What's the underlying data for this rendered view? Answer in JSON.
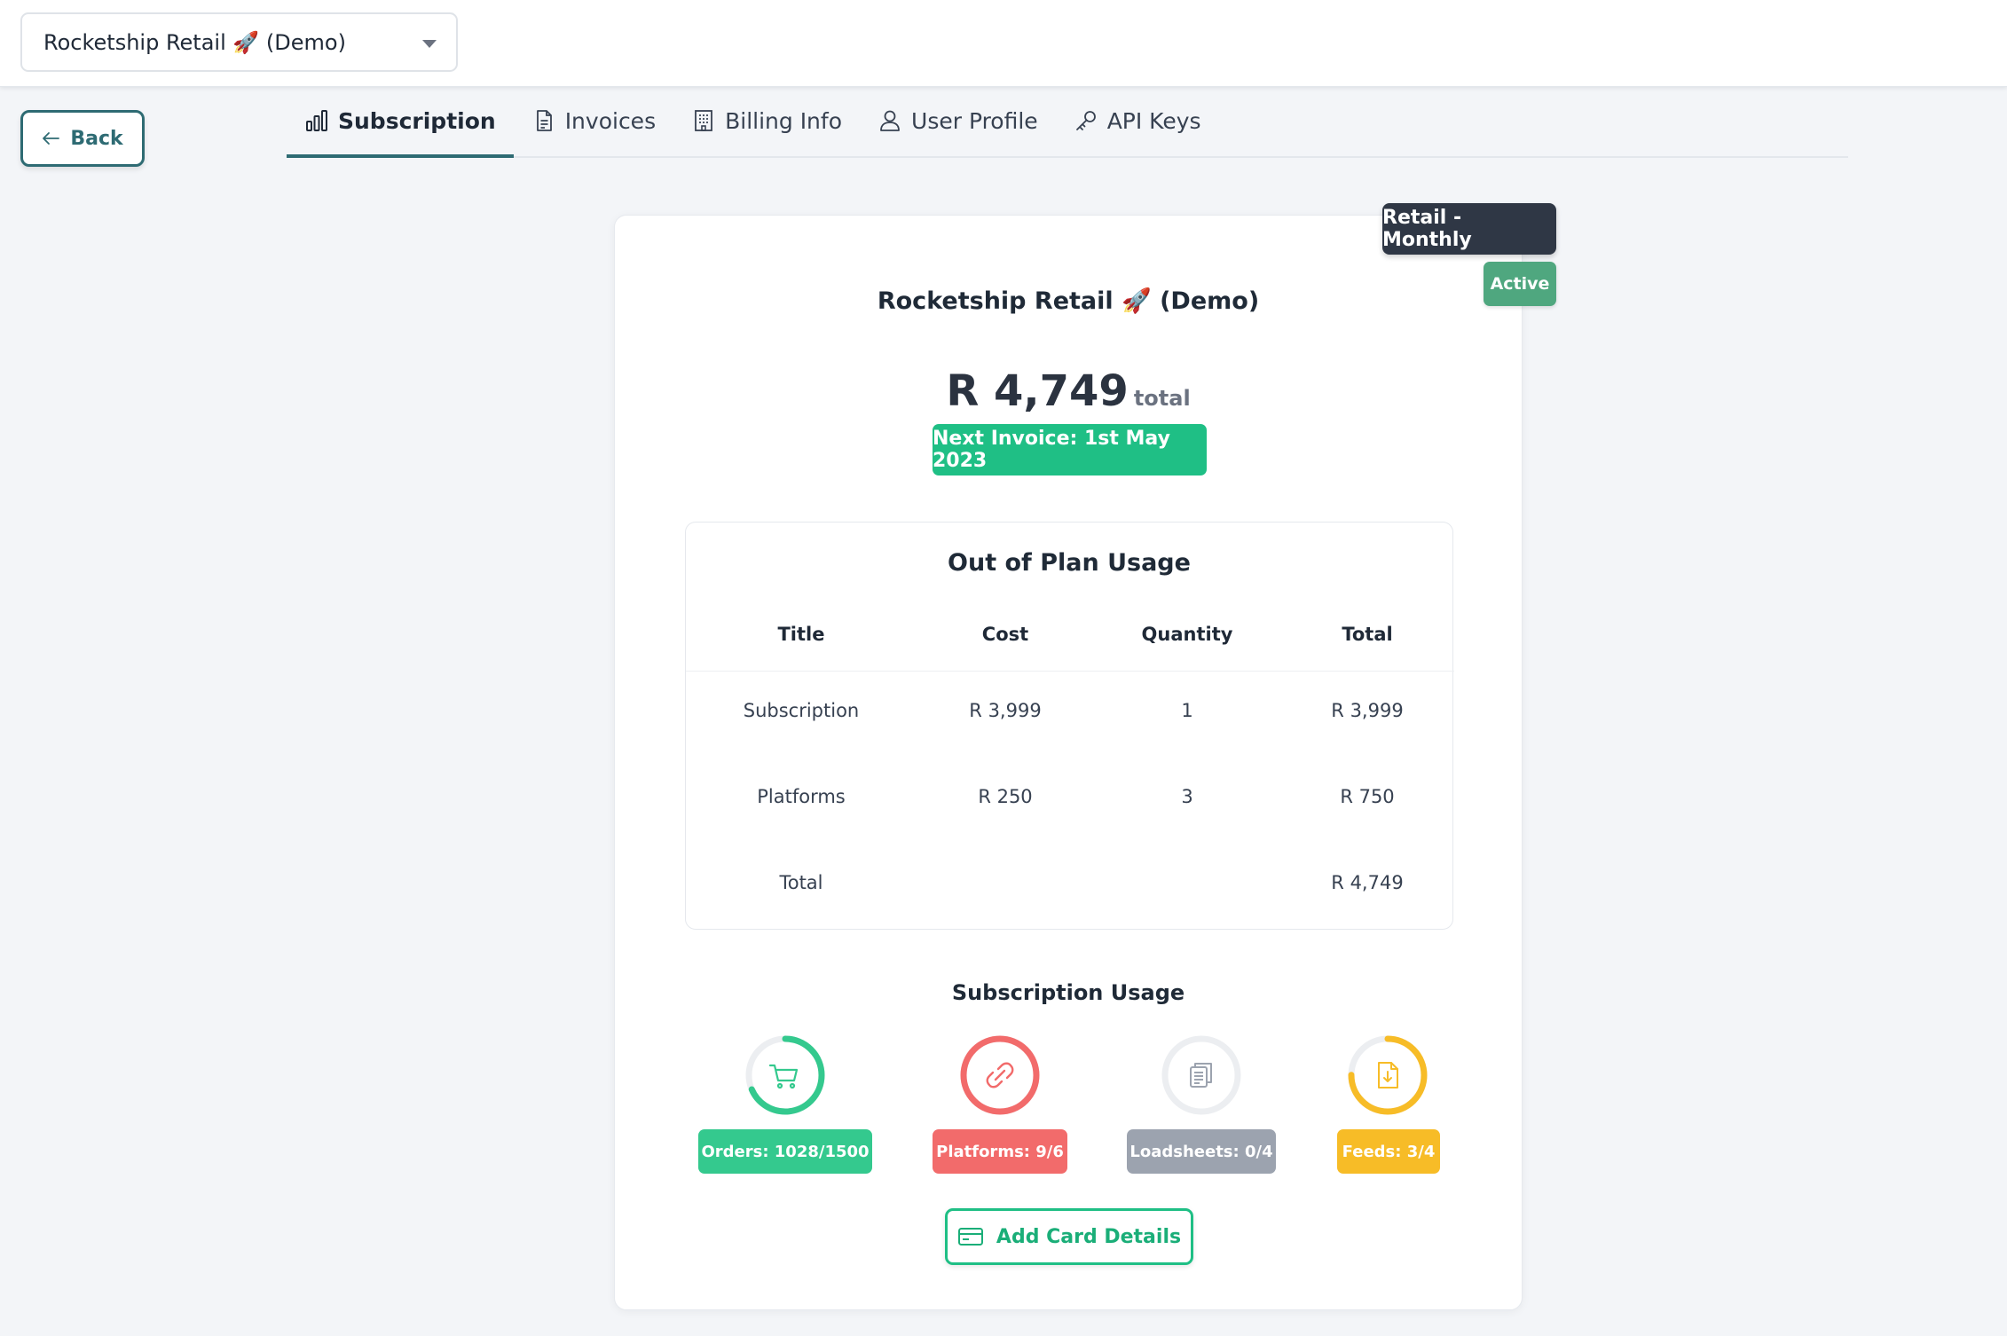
{
  "org_selector": {
    "value": "Rocketship Retail 🚀 (Demo)"
  },
  "back_button": {
    "label": "Back"
  },
  "tabs": [
    {
      "label": "Subscription",
      "icon": "bar-chart-icon",
      "active": true
    },
    {
      "label": "Invoices",
      "icon": "document-icon",
      "active": false
    },
    {
      "label": "Billing Info",
      "icon": "building-icon",
      "active": false
    },
    {
      "label": "User Profile",
      "icon": "user-icon",
      "active": false
    },
    {
      "label": "API Keys",
      "icon": "key-icon",
      "active": false
    }
  ],
  "subscription": {
    "plan_badge": "Retail - Monthly",
    "status_badge": "Active",
    "title": "Rocketship Retail 🚀 (Demo)",
    "total_amount": "R 4,749",
    "total_label": "total",
    "next_invoice": "Next Invoice: 1st May 2023"
  },
  "out_of_plan": {
    "title": "Out of Plan Usage",
    "columns": [
      "Title",
      "Cost",
      "Quantity",
      "Total"
    ],
    "rows": [
      [
        "Subscription",
        "R 3,999",
        "1",
        "R 3,999"
      ],
      [
        "Platforms",
        "R 250",
        "3",
        "R 750"
      ],
      [
        "Total",
        "",
        "",
        "R 4,749"
      ]
    ]
  },
  "subscription_usage": {
    "title": "Subscription Usage",
    "meters": [
      {
        "label": "Orders: 1028/1500",
        "icon": "cart-icon",
        "fraction": 0.685,
        "color": "#34c98e"
      },
      {
        "label": "Platforms: 9/6",
        "icon": "link-icon",
        "fraction": 1.0,
        "color": "#f26b6b"
      },
      {
        "label": "Loadsheets: 0/4",
        "icon": "clipboard-icon",
        "fraction": 0.0,
        "color": "#9ca3af"
      },
      {
        "label": "Feeds: 3/4",
        "icon": "file-download-icon",
        "fraction": 0.75,
        "color": "#f7bc27"
      }
    ]
  },
  "add_card_button": {
    "label": "Add Card Details"
  },
  "colors": {
    "accent": "#2e6b73",
    "success": "#1fbf85",
    "plan_badge": "#2f3745",
    "active_badge": "#4fa77f"
  }
}
